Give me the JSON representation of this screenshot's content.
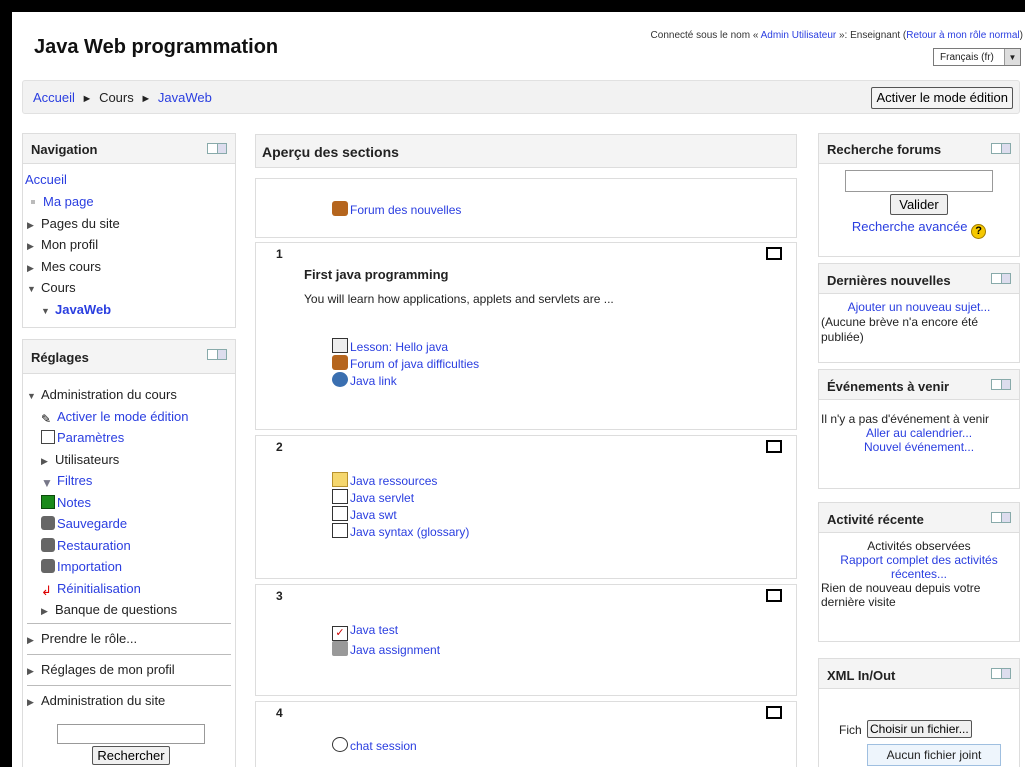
{
  "header": {
    "site_title": "Java Web programmation",
    "login_prefix": "Connecté sous le nom « ",
    "login_user": "Admin Utilisateur",
    "login_mid": " »: Enseignant (",
    "login_return": "Retour à mon rôle normal",
    "login_suffix": ")",
    "language": "Français (fr)"
  },
  "breadcrumb": {
    "items": [
      "Accueil",
      "Cours",
      "JavaWeb"
    ],
    "separator": "►"
  },
  "edit_button": "Activer le mode édition",
  "navigation": {
    "title": "Navigation",
    "home": "Accueil",
    "items": [
      "Ma page",
      "Pages du site",
      "Mon profil",
      "Mes cours",
      "Cours",
      "JavaWeb"
    ]
  },
  "settings": {
    "title": "Réglages",
    "course_admin": "Administration du cours",
    "items": [
      "Activer le mode édition",
      "Paramètres",
      "Utilisateurs",
      "Filtres",
      "Notes",
      "Sauvegarde",
      "Restauration",
      "Importation",
      "Réinitialisation",
      "Banque de questions"
    ],
    "take_role": "Prendre le rôle...",
    "profile_settings": "Réglages de mon profil",
    "site_admin": "Administration du site",
    "search_button": "Rechercher"
  },
  "sections": {
    "title": "Aperçu des sections",
    "general": {
      "forum": "Forum des nouvelles"
    },
    "s1": {
      "number": "1",
      "name": "First java programming",
      "summary": "You will learn how applications, applets and servlets are ...",
      "activities": [
        "Lesson: Hello java",
        "Forum of java difficulties",
        "Java link"
      ]
    },
    "s2": {
      "number": "2",
      "activities": [
        "Java ressources",
        "Java servlet",
        "Java swt",
        "Java syntax (glossary)"
      ]
    },
    "s3": {
      "number": "3",
      "activities": [
        "Java test",
        "Java assignment"
      ]
    },
    "s4": {
      "number": "4",
      "activities": [
        "chat session"
      ]
    }
  },
  "search_forums": {
    "title": "Recherche forums",
    "button": "Valider",
    "advanced": "Recherche avancée"
  },
  "latest_news": {
    "title": "Dernières nouvelles",
    "add": "Ajouter un nouveau sujet...",
    "empty": "(Aucune brève n'a encore été publiée)"
  },
  "upcoming": {
    "title": "Événements à venir",
    "empty": "Il n'y a pas d'événement à venir",
    "calendar": "Aller au calendrier...",
    "new_event": "Nouvel événement..."
  },
  "recent_activity": {
    "title": "Activité récente",
    "observed": "Activités observées",
    "full_report": "Rapport complet des activités récentes...",
    "nothing": "Rien de nouveau depuis votre dernière visite"
  },
  "xml": {
    "title": "XML In/Out",
    "file_label": "Fich",
    "choose_file": "Choisir un fichier...",
    "no_file": "Aucun fichier joint"
  },
  "colors": {
    "link": "#2a3ee0",
    "block_header": "#f4f4f4",
    "border": "#dddddd"
  },
  "icons": [
    "forum-icon",
    "lesson-icon",
    "url-icon",
    "folder-icon",
    "resource-icon",
    "quiz-icon",
    "assignment-icon",
    "chat-icon",
    "help-icon",
    "dock-icon"
  ]
}
